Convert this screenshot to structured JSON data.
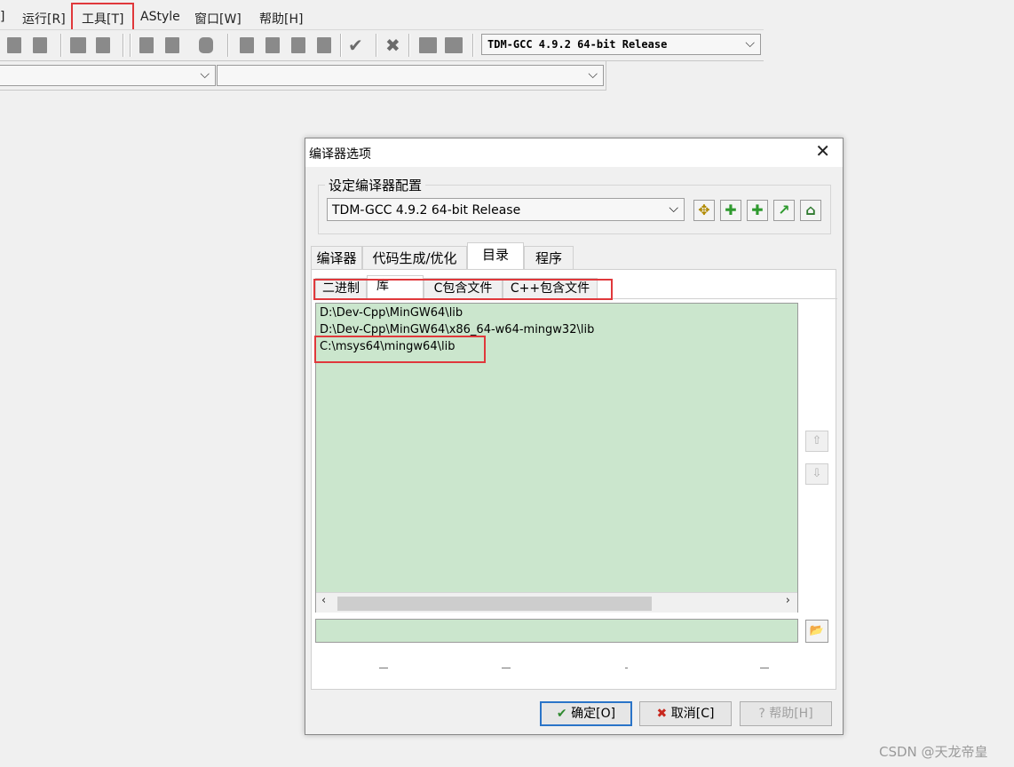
{
  "menubar": {
    "items": [
      {
        "label": "运行[R]"
      },
      {
        "label": "工具[T]"
      },
      {
        "label": "AStyle"
      },
      {
        "label": "窗口[W]"
      },
      {
        "label": "帮助[H]"
      }
    ],
    "partial_left": "]"
  },
  "toolbar": {
    "compiler_select": "TDM-GCC 4.9.2 64-bit Release"
  },
  "dialog": {
    "title": "编译器选项",
    "group_label": "设定编译器配置",
    "config_select": "TDM-GCC 4.9.2 64-bit Release",
    "tabs": [
      {
        "label": "编译器"
      },
      {
        "label": "代码生成/优化"
      },
      {
        "label": "目录"
      },
      {
        "label": "程序"
      }
    ],
    "subtabs": [
      {
        "label": "二进制"
      },
      {
        "label": "库"
      },
      {
        "label": "C包含文件"
      },
      {
        "label": "C++包含文件"
      }
    ],
    "list_items": [
      "D:\\Dev-Cpp\\MinGW64\\lib",
      "D:\\Dev-Cpp\\MinGW64\\x86_64-w64-mingw32\\lib",
      "C:\\msys64\\mingw64\\lib"
    ],
    "path_input_value": "",
    "buttons": {
      "ok": "确定[O]",
      "cancel": "取消[C]",
      "help": "帮助[H]"
    }
  },
  "watermark": "CSDN @天龙帝皇",
  "colors": {
    "list_bg": "#cbe6cd",
    "highlight_box": "#e0383b",
    "default_button_border": "#2a74c8"
  }
}
